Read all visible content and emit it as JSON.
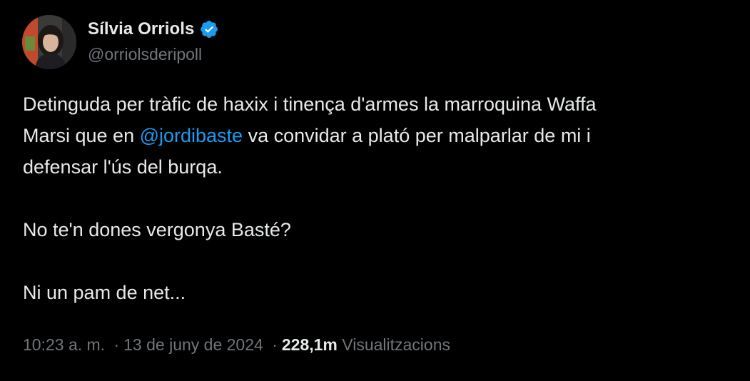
{
  "author": {
    "display_name": "Sílvia Orriols",
    "handle": "@orriolsderipoll",
    "verified_icon": "verified-badge-icon",
    "verified_color": "#1d9bf0"
  },
  "tweet": {
    "line1": "Detinguda per tràfic de haxix i tinença d'armes la marroquina Waffa",
    "line2_before": "Marsi que en ",
    "line2_mention": "@jordibaste",
    "line2_after": " va convidar a plató per malparlar de mi i",
    "line3": "defensar l'ús del burqa.",
    "line4": "No te'n dones vergonya Basté?",
    "line5": "Ni un pam de net..."
  },
  "meta": {
    "time": "10:23 a. m.",
    "separator": "·",
    "date": "13 de juny de 2024",
    "views_count": "228,1m",
    "views_label": "Visualitzacions"
  },
  "colors": {
    "background": "#000000",
    "text": "#e7e9ea",
    "secondary": "#71767b",
    "accent": "#1d9bf0"
  }
}
